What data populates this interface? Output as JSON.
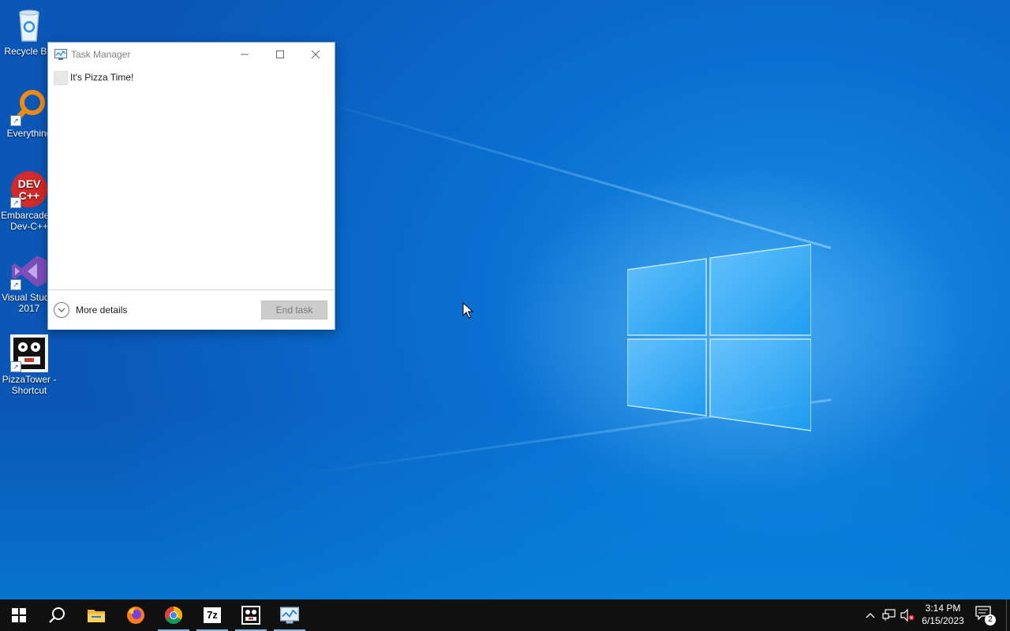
{
  "desktop": {
    "icons": [
      {
        "label": "Recycle Bin",
        "icon": "recycle-bin-icon"
      },
      {
        "label": "Everything",
        "icon": "everything-search-icon",
        "glyph": "⚲"
      },
      {
        "label": "Embarcadero\nDev-C++",
        "icon": "devcpp-icon",
        "glyph_top": "DEV",
        "glyph_bottom": "C++"
      },
      {
        "label": "Visual Studio\n2017",
        "icon": "visual-studio-icon"
      },
      {
        "label": "PizzaTower -\nShortcut",
        "icon": "pizzatower-icon"
      }
    ],
    "shortcut_glyph": "↗"
  },
  "task_manager": {
    "title": "Task Manager",
    "minimize_glyph": "—",
    "maximize_glyph": "☐",
    "close_glyph": "✕",
    "processes": [
      {
        "name": "It's Pizza Time!"
      }
    ],
    "more_details_label": "More details",
    "end_task_label": "End task"
  },
  "taskbar": {
    "pinned": [
      {
        "icon": "start-windows-icon"
      },
      {
        "icon": "search-icon"
      },
      {
        "icon": "file-explorer-icon"
      },
      {
        "icon": "firefox-icon"
      },
      {
        "icon": "chrome-icon"
      },
      {
        "icon": "7zip-icon",
        "glyph": "7z"
      },
      {
        "icon": "pizzatower-icon"
      },
      {
        "icon": "task-manager-icon"
      }
    ],
    "tray": {
      "chevron_glyph": "^",
      "clock_time": "3:14 PM",
      "clock_date": "6/15/2023",
      "notification_count": "2"
    }
  },
  "colors": {
    "accent": "#0078d7",
    "taskbar": "#101010",
    "button_disabled": "#cccccc"
  }
}
